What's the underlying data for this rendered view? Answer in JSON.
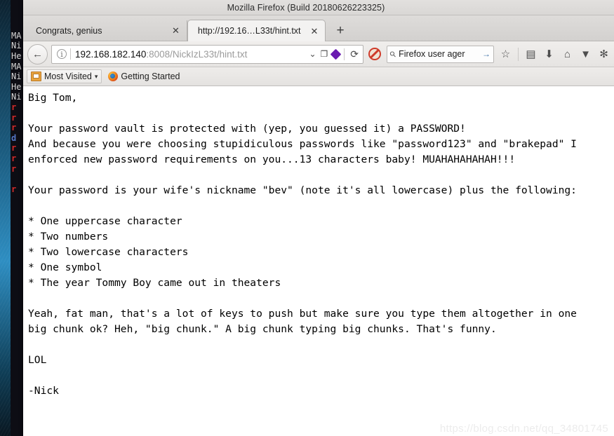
{
  "desktop": {
    "terminal": {
      "lines": [
        {
          "text": "",
          "color": "white"
        },
        {
          "text": "",
          "color": "white"
        },
        {
          "text": "",
          "color": "white"
        },
        {
          "text": "MA",
          "color": "white"
        },
        {
          "text": "Ni",
          "color": "white"
        },
        {
          "text": "He",
          "color": "white"
        },
        {
          "text": "MA",
          "color": "white"
        },
        {
          "text": "Ni",
          "color": "white"
        },
        {
          "text": "He",
          "color": "white"
        },
        {
          "text": "Ni",
          "color": "white"
        },
        {
          "text": "r",
          "color": "red"
        },
        {
          "text": "r",
          "color": "red"
        },
        {
          "text": "r",
          "color": "red"
        },
        {
          "text": "d",
          "color": "blue"
        },
        {
          "text": "r",
          "color": "red"
        },
        {
          "text": "r",
          "color": "red"
        },
        {
          "text": "r",
          "color": "red"
        },
        {
          "text": "",
          "color": "white"
        },
        {
          "text": "r",
          "color": "red"
        }
      ]
    }
  },
  "window": {
    "title": "Mozilla Firefox (Build 20180626223325)"
  },
  "tabs": [
    {
      "label": "Congrats, genius",
      "active": false,
      "close_label": "✕"
    },
    {
      "label": "http://192.16…L33t/hint.txt",
      "active": true,
      "close_label": "✕"
    }
  ],
  "newtab": {
    "label": "+"
  },
  "toolbar": {
    "back_label": "←",
    "url": {
      "host": "192.168.182.140",
      "path": ":8008/NickIzL33t/hint.txt",
      "info_label": "i",
      "dropdown_label": "⌄",
      "reader_label": "❐",
      "pocket_label": "",
      "reload_label": "⟳"
    },
    "noscript_label": "",
    "search": {
      "value": "Firefox user ager",
      "placeholder": "Search",
      "magnifier_label": "⚲",
      "go_label": "→"
    },
    "icons": [
      {
        "name": "bookmark-star-icon",
        "glyph": "☆"
      },
      {
        "name": "library-icon",
        "glyph": "▤"
      },
      {
        "name": "downloads-icon",
        "glyph": "⬇"
      },
      {
        "name": "home-icon",
        "glyph": "⌂"
      },
      {
        "name": "shield-pocket-icon",
        "glyph": "▼"
      },
      {
        "name": "extension-icon",
        "glyph": "✻"
      }
    ]
  },
  "bookmarks": [
    {
      "label": "Most Visited",
      "icon": "folder-icon",
      "caret": "▾",
      "boxed": true
    },
    {
      "label": "Getting Started",
      "icon": "firefox-logo-icon",
      "caret": "",
      "boxed": false
    }
  ],
  "page": {
    "body": "Big Tom,\n\nYour password vault is protected with (yep, you guessed it) a PASSWORD!\nAnd because you were choosing stupidiculous passwords like \"password123\" and \"brakepad\" I\nenforced new password requirements on you...13 characters baby! MUAHAHAHAHAH!!!\n\nYour password is your wife's nickname \"bev\" (note it's all lowercase) plus the following:\n\n* One uppercase character\n* Two numbers\n* Two lowercase characters\n* One symbol\n* The year Tommy Boy came out in theaters\n\nYeah, fat man, that's a lot of keys to push but make sure you type them altogether in one\nbig chunk ok? Heh, \"big chunk.\" A big chunk typing big chunks. That's funny.\n\nLOL\n\n-Nick",
    "watermark": "https://blog.csdn.net/qq_34801745"
  }
}
